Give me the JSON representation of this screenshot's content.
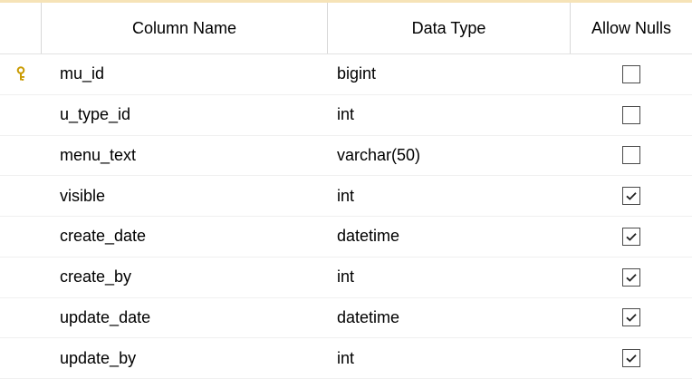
{
  "header": {
    "column_name": "Column Name",
    "data_type": "Data Type",
    "allow_nulls": "Allow Nulls"
  },
  "rows": [
    {
      "column_name": "mu_id",
      "data_type": "bigint",
      "allow_nulls": false,
      "primary_key": true
    },
    {
      "column_name": "u_type_id",
      "data_type": "int",
      "allow_nulls": false,
      "primary_key": false
    },
    {
      "column_name": "menu_text",
      "data_type": "varchar(50)",
      "allow_nulls": false,
      "primary_key": false
    },
    {
      "column_name": "visible",
      "data_type": "int",
      "allow_nulls": true,
      "primary_key": false
    },
    {
      "column_name": "create_date",
      "data_type": "datetime",
      "allow_nulls": true,
      "primary_key": false
    },
    {
      "column_name": "create_by",
      "data_type": "int",
      "allow_nulls": true,
      "primary_key": false
    },
    {
      "column_name": "update_date",
      "data_type": "datetime",
      "allow_nulls": true,
      "primary_key": false
    },
    {
      "column_name": "update_by",
      "data_type": "int",
      "allow_nulls": true,
      "primary_key": false
    }
  ],
  "icons": {
    "primary_key": "key-icon",
    "checked": "checkmark-icon"
  },
  "colors": {
    "key_gold": "#d6a800",
    "checkbox_border": "#4a4a4a",
    "header_accent": "#f6e3b7"
  }
}
